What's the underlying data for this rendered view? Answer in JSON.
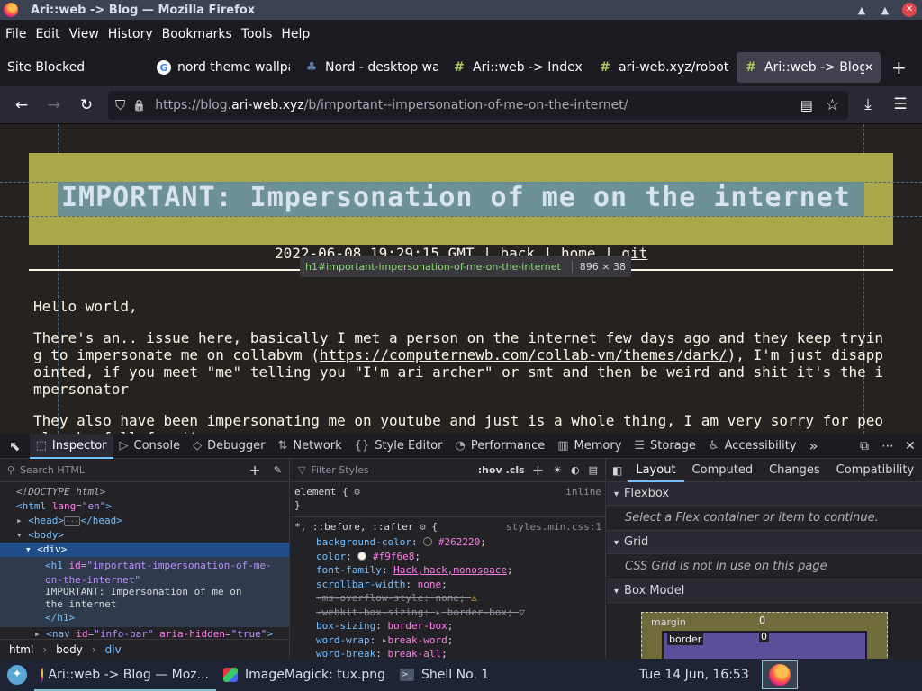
{
  "window": {
    "title": "Ari::web -> Blog — Mozilla Firefox",
    "minimize_glyph": "▲",
    "maximize_glyph": "▲",
    "close_glyph": "✕"
  },
  "menu": [
    "File",
    "Edit",
    "View",
    "History",
    "Bookmarks",
    "Tools",
    "Help"
  ],
  "tabs": [
    {
      "label": "Site Blocked",
      "icon": "",
      "icon_name": "none"
    },
    {
      "label": "nord theme wallpa",
      "icon": "G",
      "icon_name": "google-icon"
    },
    {
      "label": "Nord - desktop wa",
      "icon": "♣",
      "icon_name": "people-icon"
    },
    {
      "label": "Ari::web -> Index",
      "icon": "#",
      "icon_name": "hash-icon"
    },
    {
      "label": "ari-web.xyz/robots",
      "icon": "#",
      "icon_name": "hash-icon"
    },
    {
      "label": "Ari::web -> Blog",
      "icon": "#",
      "icon_name": "hash-icon",
      "active": true
    }
  ],
  "tab_close": "✕",
  "new_tab": "+",
  "nav": {
    "back": "←",
    "forward": "→",
    "reload": "↻",
    "shield": "⛉",
    "lock": "🔒",
    "url_prefix": "https://blog.",
    "url_domain": "ari-web.xyz",
    "url_path": "/b/important--impersonation-of-me-on-the-internet/",
    "reader": "▤",
    "star": "☆",
    "download": "⤓",
    "menu": "☰"
  },
  "page": {
    "h1": "IMPORTANT: Impersonation of me on the internet",
    "info": {
      "date": "2022-06-08 19:29:15 GMT",
      "sep": "|",
      "links": [
        "back",
        "home",
        "git"
      ]
    },
    "tooltip_selector": "h1#important-impersonation-of-me-on-the-internet",
    "tooltip_dims": "896 × 38",
    "p1": "Hello world,",
    "p2_a": "There's an.. issue here, basically I met a person on the internet few days ago and they keep trying to impersonate me on collabvm (",
    "p2_link": "https://computernewb.com/collab-vm/themes/dark/",
    "p2_b": "), I'm just disappointed, if you meet \"me\" telling you \"I'm ari archer\" or smt and then be weird and shit it's the impersonator",
    "p3": "They also have been impersonating me on youtube and just is a whole thing, I am very sorry for people who fell for it"
  },
  "devtools": {
    "tabs": [
      {
        "label": "Inspector",
        "icon": "⬚",
        "selected": true
      },
      {
        "label": "Console",
        "icon": "▷"
      },
      {
        "label": "Debugger",
        "icon": "◇"
      },
      {
        "label": "Network",
        "icon": "⇅"
      },
      {
        "label": "Style Editor",
        "icon": "{}"
      },
      {
        "label": "Performance",
        "icon": "◔"
      },
      {
        "label": "Memory",
        "icon": "▥"
      },
      {
        "label": "Storage",
        "icon": "☰"
      },
      {
        "label": "Accessibility",
        "icon": "♿"
      }
    ],
    "more": "»",
    "search_html": "Search HTML",
    "filter_styles": "Filter Styles",
    "hov": ":hov",
    "cls": ".cls",
    "markup": {
      "doctype": "<!DOCTYPE html>",
      "html_open": "<html",
      "html_attr": "lang",
      "html_val": "\"en\"",
      "head": "<head>",
      "head_close": "</head>",
      "body": "<body>",
      "div": "<div>",
      "h1_open": "<h1",
      "h1_attr": "id",
      "h1_val": "\"important-impersonation-of-me-on-the-internet\"",
      "h1_text": "IMPORTANT: Impersonation of me on the internet",
      "h1_close": "</h1>",
      "nav_open": "<nav",
      "nav_attr1": "id",
      "nav_val1": "\"info-bar\"",
      "nav_attr2": "aria-hidden",
      "nav_val2": "\"true\""
    },
    "breadcrumbs": [
      "html",
      "body",
      "div"
    ],
    "rules": {
      "element": "element {",
      "element_close": "}",
      "inline": "inline",
      "selector": "*, ::before, ::after",
      "source": "styles.min.css:1",
      "decls": [
        {
          "p": "background-color",
          "v": "#262220",
          "swatch": "#262220"
        },
        {
          "p": "color",
          "v": "#f9f6e8",
          "swatch": "#f9f6e8"
        },
        {
          "p": "font-family",
          "v": "Hack,hack,monospace"
        },
        {
          "p": "scrollbar-width",
          "v": "none"
        },
        {
          "p": "-ms-overflow-style",
          "v": "none",
          "struck": true
        },
        {
          "p": "-webkit-box-sizing",
          "v": "border-box",
          "struck": true
        },
        {
          "p": "box-sizing",
          "v": "border-box"
        },
        {
          "p": "word-wrap",
          "v": "break-word"
        },
        {
          "p": "word-break",
          "v": "break-all"
        }
      ]
    },
    "layout_tabs": [
      "Layout",
      "Computed",
      "Changes",
      "Compatibility"
    ],
    "flexbox": "Flexbox",
    "flexbox_msg": "Select a Flex container or item to continue.",
    "grid": "Grid",
    "grid_msg": "CSS Grid is not in use on this page",
    "boxmodel": "Box Model",
    "margin_label": "margin",
    "margin_val": "0",
    "border_label": "border",
    "border_val": "0"
  },
  "taskbar": {
    "items": [
      {
        "label": "Ari::web -> Blog — Moz...",
        "icon_name": "firefox-icon"
      },
      {
        "label": "ImageMagick: tux.png",
        "icon_name": "imagemagick-icon"
      },
      {
        "label": "Shell No. 1",
        "icon_name": "terminal-icon"
      }
    ],
    "clock": "Tue 14 Jun, 16:53"
  },
  "colors": {
    "accent": "#75bfff",
    "page_bg": "#262220",
    "header_band": "#a8a84a",
    "taskbar": "#1e2433"
  }
}
